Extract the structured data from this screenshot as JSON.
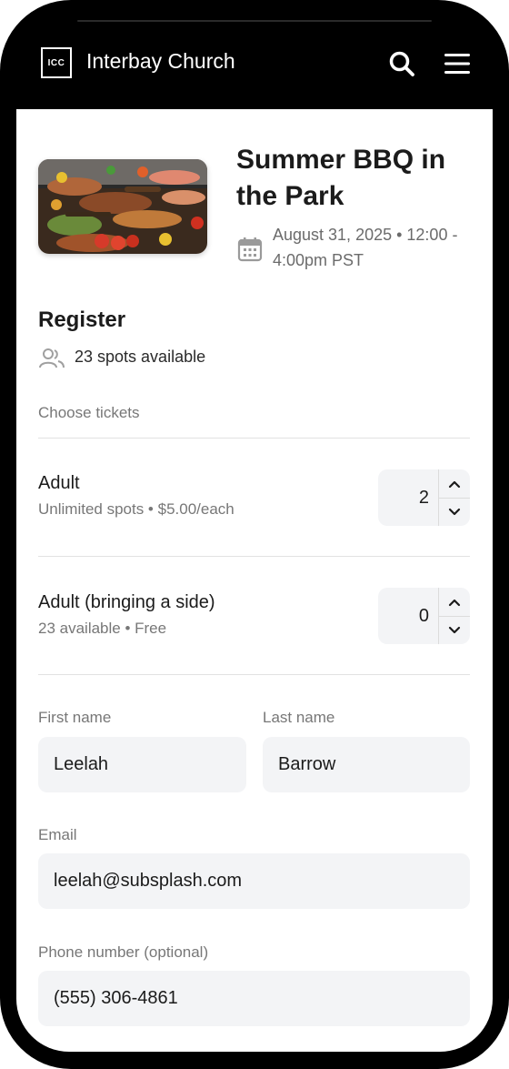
{
  "header": {
    "logo_text": "ICC",
    "church_name": "Interbay Church"
  },
  "event": {
    "title": "Summer BBQ in the Park",
    "date": "August 31, 2025 • 12:00 - 4:00pm PST"
  },
  "register": {
    "title": "Register",
    "spots": "23 spots available",
    "choose_label": "Choose tickets"
  },
  "tickets": [
    {
      "name": "Adult",
      "details": "Unlimited spots • $5.00/each",
      "quantity": "2"
    },
    {
      "name": "Adult (bringing a side)",
      "details": "23 available • Free",
      "quantity": "0"
    }
  ],
  "form": {
    "first_name": {
      "label": "First name",
      "value": "Leelah"
    },
    "last_name": {
      "label": "Last name",
      "value": "Barrow"
    },
    "email": {
      "label": "Email",
      "value": "leelah@subsplash.com"
    },
    "phone": {
      "label": "Phone number (optional)",
      "value": "(555) 306-4861"
    }
  }
}
